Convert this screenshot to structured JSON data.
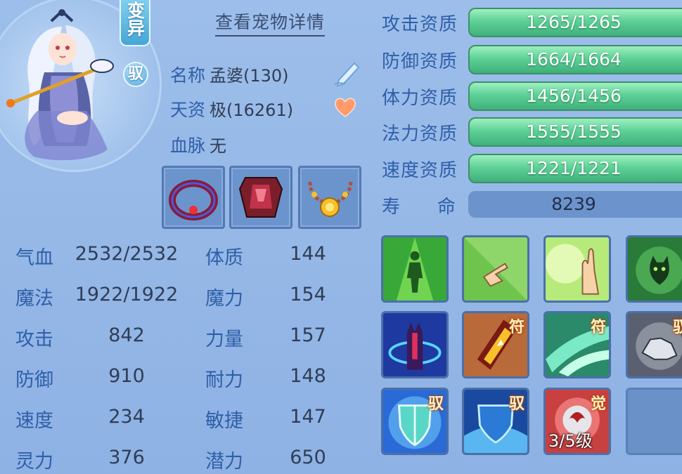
{
  "pet": {
    "tags": {
      "variant": "变异",
      "tamed": "驭"
    },
    "detail_link": "查看宠物详情",
    "name_label": "名称",
    "name_value": "孟婆(130)",
    "talent_label": "天资",
    "talent_value": "极(16261)",
    "bloodline_label": "血脉",
    "bloodline_value": "无"
  },
  "stats": [
    {
      "label": "气血",
      "value": "2532/2532"
    },
    {
      "label": "魔法",
      "value": "1922/1922"
    },
    {
      "label": "攻击",
      "value": "842"
    },
    {
      "label": "防御",
      "value": "910"
    },
    {
      "label": "速度",
      "value": "234"
    },
    {
      "label": "灵力",
      "value": "376"
    }
  ],
  "attrs": [
    {
      "label": "体质",
      "value": "144"
    },
    {
      "label": "魔力",
      "value": "154"
    },
    {
      "label": "力量",
      "value": "157"
    },
    {
      "label": "耐力",
      "value": "148"
    },
    {
      "label": "敏捷",
      "value": "147"
    },
    {
      "label": "潜力",
      "value": "650"
    }
  ],
  "aptitudes": [
    {
      "label": "攻击资质",
      "value": "1265/1265"
    },
    {
      "label": "防御资质",
      "value": "1664/1664"
    },
    {
      "label": "体力资质",
      "value": "1456/1456"
    },
    {
      "label": "法力资质",
      "value": "1555/1555"
    },
    {
      "label": "速度资质",
      "value": "1221/1221"
    }
  ],
  "life": {
    "label_a": "寿",
    "label_b": "命",
    "value": "8239"
  },
  "skills": [
    {
      "icon": "figure-aura-icon",
      "badge": ""
    },
    {
      "icon": "pointing-hand-icon",
      "badge": ""
    },
    {
      "icon": "palm-light-icon",
      "badge": ""
    },
    {
      "icon": "spirit-cat-icon",
      "badge": ""
    },
    {
      "icon": "shadow-hand-icon",
      "badge": ""
    },
    {
      "icon": "talisman-icon",
      "badge": "符"
    },
    {
      "icon": "wind-slash-icon",
      "badge": "符"
    },
    {
      "icon": "stone-beast-icon",
      "badge": "驭"
    },
    {
      "icon": "shield-glow-icon",
      "badge": "驭"
    },
    {
      "icon": "water-shield-icon",
      "badge": "驭"
    },
    {
      "icon": "awaken-orb-icon",
      "badge": "觉",
      "level": "3/5级"
    },
    {
      "icon": "",
      "badge": ""
    }
  ]
}
